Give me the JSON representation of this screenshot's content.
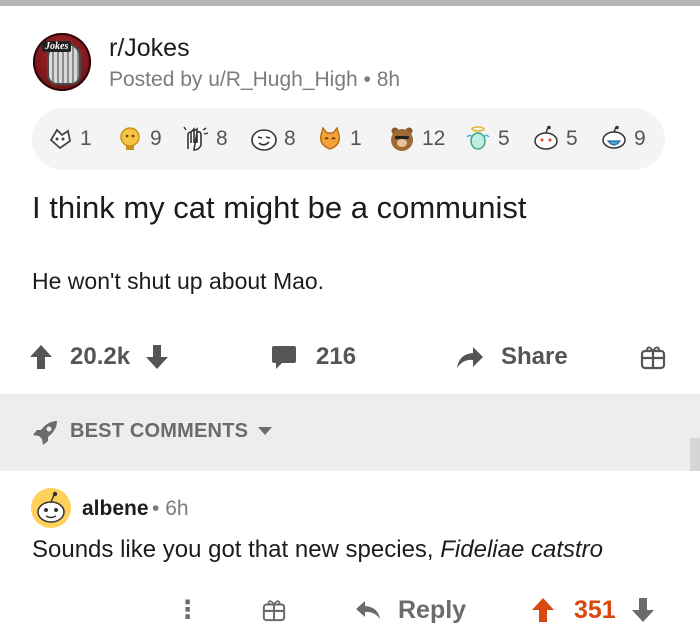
{
  "post": {
    "subreddit": "r/Jokes",
    "avatar_text": "Jokes",
    "posted_prefix": "Posted by",
    "author": "u/R_Hugh_High",
    "separator": "•",
    "age": "8h",
    "awards": [
      {
        "icon": "wholesome-award-icon",
        "count": "1"
      },
      {
        "icon": "gold-trophy-award-icon",
        "count": "9"
      },
      {
        "icon": "clapping-hands-award-icon",
        "count": "8"
      },
      {
        "icon": "lol-face-award-icon",
        "count": "8"
      },
      {
        "icon": "cat-award-icon",
        "count": "1"
      },
      {
        "icon": "bear-hug-award-icon",
        "count": "12"
      },
      {
        "icon": "angel-award-icon",
        "count": "5"
      },
      {
        "icon": "snoo-party-award-icon",
        "count": "5"
      },
      {
        "icon": "snoo-mask-award-icon",
        "count": "9"
      }
    ],
    "title": "I think my cat might be a communist",
    "body": "He won't shut up about Mao.",
    "votes": "20.2k",
    "comments": "216",
    "share_label": "Share"
  },
  "sort": {
    "label": "BEST COMMENTS"
  },
  "comment": {
    "user": "albene",
    "separator": "•",
    "age": "6h",
    "text_plain": "Sounds like you got that new species, ",
    "text_italic": "Fideliae catstro",
    "more_label": "⋮",
    "reply_label": "Reply",
    "votes": "351"
  },
  "colors": {
    "upvote_active": "#d9480f",
    "muted": "#7c7c7c",
    "sort_bg": "#ededed",
    "awards_bg": "#f4f4f4"
  }
}
